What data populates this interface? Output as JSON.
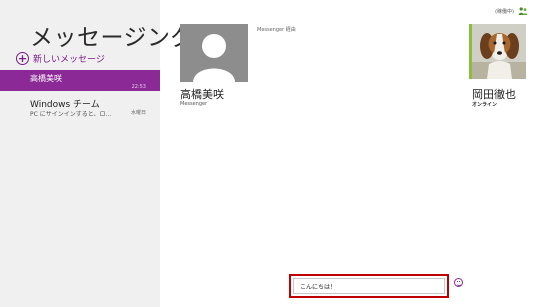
{
  "app": {
    "title": "メッセージング"
  },
  "sidebar": {
    "new_message_label": "新しいメッセージ",
    "conversations": [
      {
        "name": "高橋美咲",
        "preview": "",
        "time": "22:53",
        "selected": true
      },
      {
        "name": "Windows チーム",
        "preview": "PC にサインインすると、ロ…",
        "time": "水曜日",
        "selected": false
      }
    ]
  },
  "status": {
    "label": "(稼働中)",
    "icon": "people-icon"
  },
  "conversation": {
    "self": {
      "name": "高橋美咲",
      "status": "Messenger",
      "avatar": "default-avatar-icon"
    },
    "meta": "Messenger 経由",
    "contact": {
      "name": "岡田徹也",
      "status": "オンライン",
      "presence_color": "#8bbf3a",
      "avatar": "dog-photo"
    },
    "compose": {
      "value": "こんにちは！"
    },
    "emoticon_icon": "smiley-icon"
  },
  "colors": {
    "accent": "#8b2a96",
    "compose_highlight": "#c00000",
    "sidebar_bg": "#f0f0f0"
  }
}
